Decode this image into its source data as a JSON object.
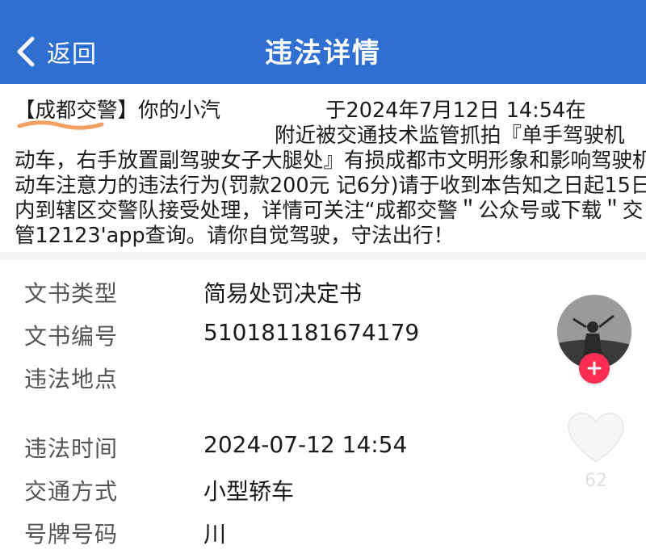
{
  "header": {
    "back_label": "返回",
    "title": "违法详情",
    "background": "#2f6fd1"
  },
  "message": {
    "line1a": "【成都交警】你的小汽",
    "line1b": "于2024年7月12日 14:54在",
    "line2": "附近被交通技术监管抓拍『单手驾驶机",
    "line3": "动车，右手放置副驾驶女子大腿处』有损成都市文明形象和影响驾驶机",
    "line4": "动车注意力的违法行为(罚款200元 记6分)请于收到本告知之日起15日",
    "line5": "内到辖区交警队接受处理，详情可关注“成都交警＂公众号或下载＂交",
    "line6": "管12123'app查询。请你自觉驾驶，守法出行！"
  },
  "fields": [
    {
      "label": "文书类型",
      "value": "简易处罚决定书"
    },
    {
      "label": "文书编号",
      "value": "510181181674179"
    },
    {
      "label": "违法地点",
      "value": ""
    },
    {
      "label": "违法时间",
      "value": "2024-07-12 14:54"
    },
    {
      "label": "交通方式",
      "value": "小型轿车"
    },
    {
      "label": "号牌号码",
      "value": "川"
    }
  ],
  "overlay": {
    "avatar_icon": "avatar",
    "follow_icon": "plus-icon",
    "like_icon": "heart-icon",
    "like_count": "62",
    "follow_color": "#fe2c55"
  }
}
